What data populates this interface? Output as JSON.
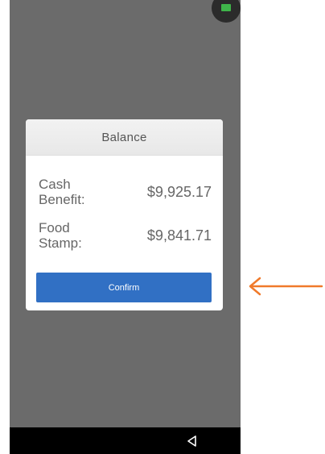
{
  "dialog": {
    "title": "Balance",
    "rows": [
      {
        "label": "Cash Benefit:",
        "value": "$9,925.17"
      },
      {
        "label": "Food Stamp:",
        "value": "$9,841.71"
      }
    ],
    "confirm_label": "Confirm"
  },
  "colors": {
    "overlay": "#6b6b6b",
    "confirm": "#3170c4",
    "status_dot": "#3fb54a",
    "annotation_arrow": "#f07a2b"
  },
  "icons": {
    "status": "status-indicator-icon",
    "back": "back-triangle-icon",
    "annotation": "arrow-left-icon"
  }
}
